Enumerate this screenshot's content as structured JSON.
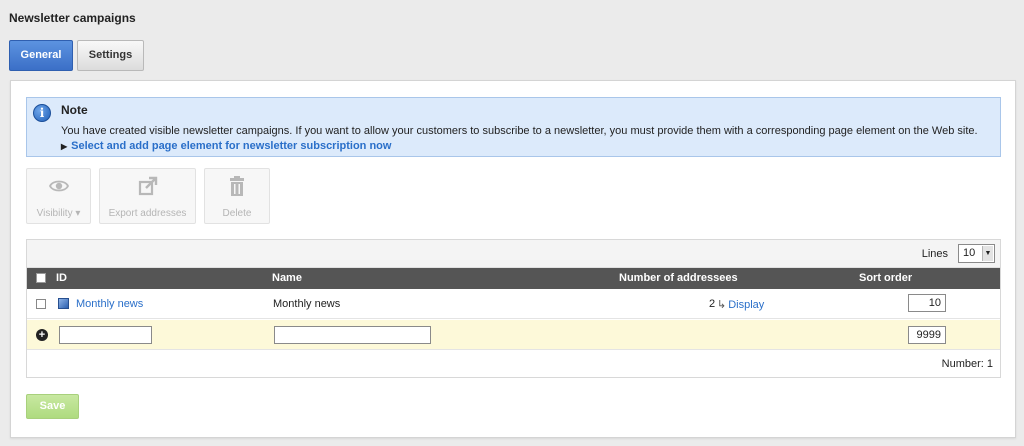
{
  "page": {
    "title": "Newsletter campaigns"
  },
  "tabs": [
    {
      "label": "General",
      "active": true
    },
    {
      "label": "Settings",
      "active": false
    }
  ],
  "note": {
    "title": "Note",
    "text": "You have created visible newsletter campaigns. If you want to allow your customers to subscribe to a newsletter, you must provide them with a corresponding page element on the Web site.",
    "link": "Select and add page element for newsletter subscription now"
  },
  "toolbar": {
    "visibility": "Visibility",
    "export": "Export addresses",
    "delete": "Delete"
  },
  "grid": {
    "lines_label": "Lines",
    "lines_value": "10",
    "columns": {
      "id": "ID",
      "name": "Name",
      "count": "Number of addressees",
      "sort": "Sort order"
    },
    "rows": [
      {
        "id": "Monthly news",
        "name": "Monthly news",
        "count": "2",
        "count_link": "Display",
        "sort": "10"
      }
    ],
    "new_row": {
      "sort": "9999"
    },
    "footer": "Number: 1"
  },
  "save_label": "Save",
  "colors": {
    "accent": "#3b6fc7",
    "link": "#2a6fc9",
    "header": "#555555",
    "new_row": "#fdf9d9",
    "save": "#aedb7f"
  }
}
